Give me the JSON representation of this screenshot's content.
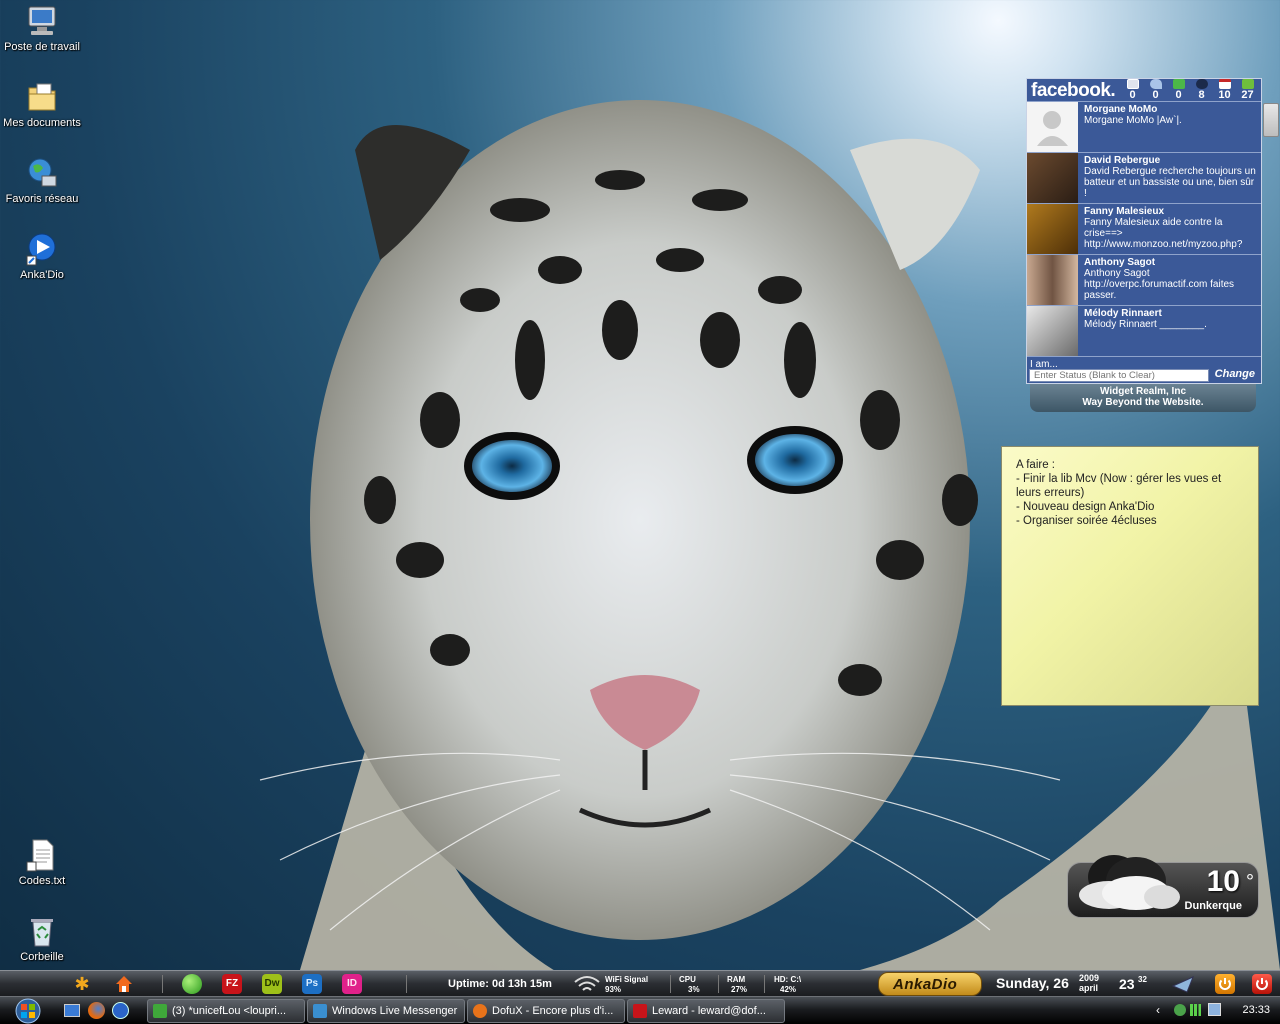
{
  "desktop_icons": [
    {
      "label": "Poste de travail",
      "icon": "computer-icon"
    },
    {
      "label": "Mes documents",
      "icon": "documents-folder-icon"
    },
    {
      "label": "Favoris réseau",
      "icon": "network-globe-icon"
    },
    {
      "label": "Anka'Dio",
      "icon": "media-play-icon"
    },
    {
      "label": "Codes.txt",
      "icon": "text-file-icon"
    },
    {
      "label": "Corbeille",
      "icon": "recycle-bin-icon"
    }
  ],
  "facebook": {
    "logo": "facebook.",
    "counts": [
      "0",
      "0",
      "0",
      "8",
      "10",
      "27"
    ],
    "count_icons": [
      "mail-icon",
      "poke-icon",
      "friend-request-icon",
      "group-icon",
      "event-icon",
      "wall-icon"
    ],
    "feed": [
      {
        "name": "Morgane MoMo",
        "text": "Morgane MoMo |Aw`|."
      },
      {
        "name": "David Rebergue",
        "text": "David Rebergue recherche toujours un batteur et un bassiste ou une, bien sûr !"
      },
      {
        "name": "Fanny Malesieux",
        "text": "Fanny Malesieux aide contre la crise==> http://www.monzoo.net/myzoo.php?"
      },
      {
        "name": "Anthony Sagot",
        "text": "Anthony Sagot http://overpc.forumactif.com faites passer."
      },
      {
        "name": "Mélody Rinnaert",
        "text": "Mélody Rinnaert ________."
      }
    ],
    "status_label": "I am...",
    "status_placeholder": "Enter Status (Blank to Clear)",
    "change_label": "Change",
    "footer_line1": "Widget Realm, Inc",
    "footer_line2": "Way Beyond the Website."
  },
  "note": {
    "text": "A faire :\n- Finir la lib Mcv (Now : gérer les vues et leurs erreurs)\n- Nouveau design Anka'Dio\n- Organiser soirée 4écluses"
  },
  "weather": {
    "temp": "10",
    "degree": "°",
    "city": "Dunkerque"
  },
  "dock": {
    "apps": [
      {
        "name": "asterisk-icon",
        "label": "",
        "color": "#f2a81d"
      },
      {
        "name": "home-icon",
        "label": "",
        "color": "#f26a1d"
      },
      {
        "name": "green-orb-icon",
        "label": "",
        "color": "#3fb52a"
      },
      {
        "name": "filezilla-icon",
        "label": "FZ",
        "color": "#c8141a"
      },
      {
        "name": "dreamweaver-icon",
        "label": "Dw",
        "color": "#9ec019"
      },
      {
        "name": "photoshop-icon",
        "label": "Ps",
        "color": "#1d6fc4"
      },
      {
        "name": "indesign-icon",
        "label": "ID",
        "color": "#e0218a"
      }
    ],
    "uptime": "Uptime: 0d 13h 15m",
    "wifi_label": "WiFi Signal",
    "wifi_value": "93%",
    "cpu_label": "CPU",
    "cpu_value": "3%",
    "ram_label": "RAM",
    "ram_value": "27%",
    "hd_label": "HD: C:\\",
    "hd_value": "42%",
    "brand": "AnkaDio",
    "date_day": "Sunday, 26",
    "date_year": "2009",
    "date_month": "april",
    "time_hour": "23",
    "time_min": "32"
  },
  "taskbar": {
    "buttons": [
      {
        "label": "(3) *unicefLou <loupri...",
        "color": "#3fa83a"
      },
      {
        "label": "Windows Live Messenger",
        "color": "#3a8fd0"
      },
      {
        "label": "DofuX - Encore plus d'i...",
        "color": "#e8731a"
      },
      {
        "label": "Leward - leward@dof...",
        "color": "#c8141a"
      }
    ],
    "clock": "23:33"
  }
}
